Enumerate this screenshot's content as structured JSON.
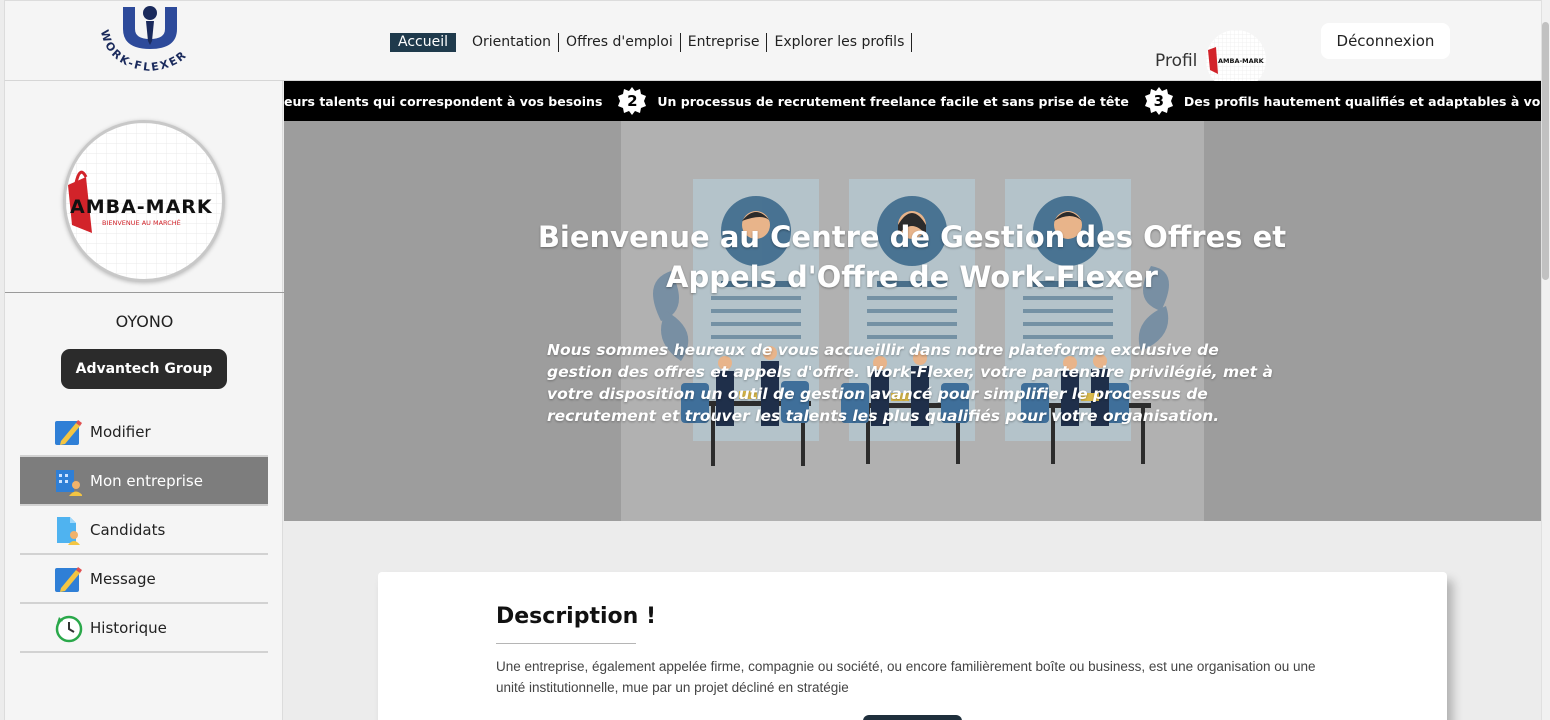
{
  "header": {
    "logo_text": "WORK-FLEXER",
    "nav": [
      {
        "label": "Accueil",
        "active": true
      },
      {
        "label": "Orientation"
      },
      {
        "label": "Offres d'emploi"
      },
      {
        "label": "Entreprise"
      },
      {
        "label": "Explorer les profils"
      }
    ],
    "profile_label": "Profil",
    "profile_avatar_text": "AMBA-MARK",
    "logout_label": "Déconnexion"
  },
  "sidebar": {
    "company_logo_text": "AMBA-MARK",
    "company_logo_subtext": "BIENVENUE AU MARCHÉ",
    "user_name": "OYONO",
    "company_name": "Advantech Group",
    "menu": [
      {
        "label": "Modifier",
        "icon": "edit-icon",
        "active": false
      },
      {
        "label": "Mon entreprise",
        "icon": "building-user-icon",
        "active": true
      },
      {
        "label": "Candidats",
        "icon": "candidate-doc-icon",
        "active": false
      },
      {
        "label": "Message",
        "icon": "message-edit-icon",
        "active": false
      },
      {
        "label": "Historique",
        "icon": "history-clock-icon",
        "active": false
      }
    ]
  },
  "ticker": [
    {
      "number": "",
      "text": "eurs talents qui correspondent à vos besoins"
    },
    {
      "number": "2",
      "text": "Un processus de recrutement freelance facile et sans prise de tête"
    },
    {
      "number": "3",
      "text": "Des profils hautement qualifiés et adaptables à vos projets"
    }
  ],
  "hero": {
    "title": "Bienvenue au Centre de Gestion des Offres et Appels d'Offre de Work-Flexer",
    "text": "Nous sommes heureux de vous accueillir dans notre plateforme exclusive de gestion des offres et appels d'offre. Work-Flexer, votre partenaire privilégié, met à votre disposition un outil de gestion avancé pour simplifier le processus de recrutement et trouver les talents les plus qualifiés pour votre organisation."
  },
  "description": {
    "title": "Description !",
    "text": "Une entreprise, également appelée firme, compagnie ou société, ou encore familièrement boîte ou business, est une organisation ou une unité institutionnelle, mue par un projet décliné en stratégie"
  },
  "colors": {
    "nav_active": "#1f3a4c",
    "sidebar_active": "#7d7d7d",
    "company_chip": "#2b2b2b",
    "ticker_bg": "#000000",
    "brand_red": "#d2232a",
    "brand_navy": "#1a2a5c"
  }
}
